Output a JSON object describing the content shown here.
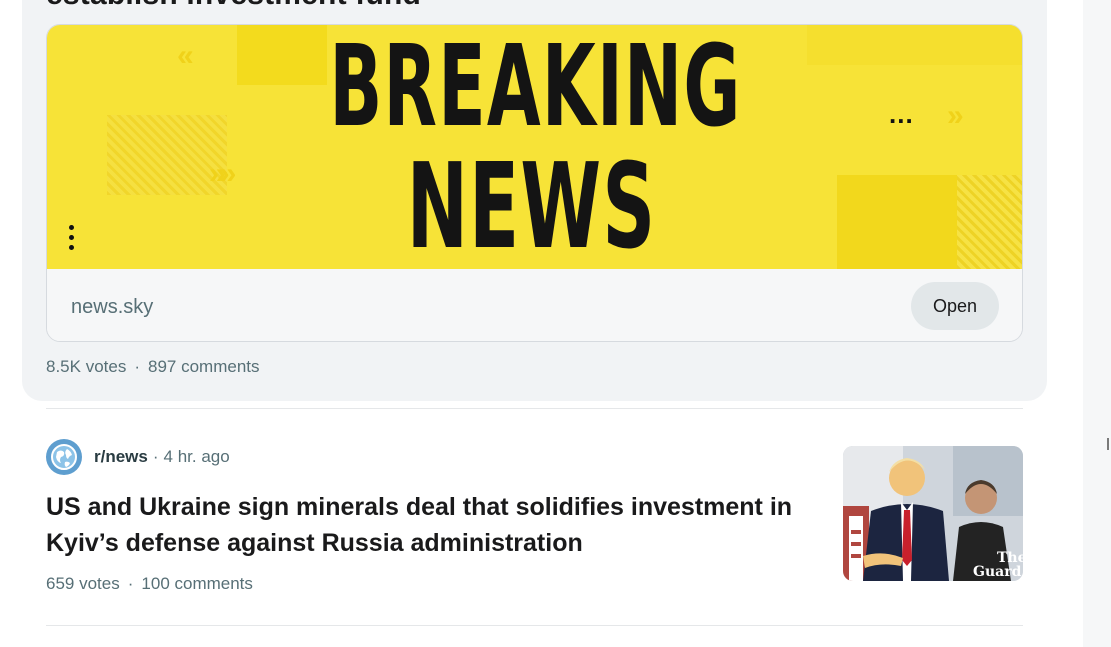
{
  "prev_post": {
    "title": "establish investment fund",
    "banner": {
      "line1": "BREAKING",
      "line2": "NEWS",
      "accent": "#f7e337",
      "more_glyph": "..."
    },
    "domain": "news.sky",
    "open_label": "Open",
    "votes": "8.5K votes",
    "separator": "·",
    "comments": "897 comments"
  },
  "post": {
    "subreddit": "r/news",
    "dot": "·",
    "time": "4 hr. ago",
    "title": "US and Ukraine sign minerals deal that solidifies investment in Kyiv’s defense against Russia administration",
    "thumbnail_watermark": {
      "line1": "The",
      "line2": "Guard"
    },
    "votes": "659 votes",
    "separator": "·",
    "comments": "100 comments"
  },
  "colors": {
    "meta_text": "#576f76",
    "card_bg": "#f1f3f5",
    "open_button_bg": "#e2e7e9",
    "subreddit_icon": "#5e9ecf"
  }
}
